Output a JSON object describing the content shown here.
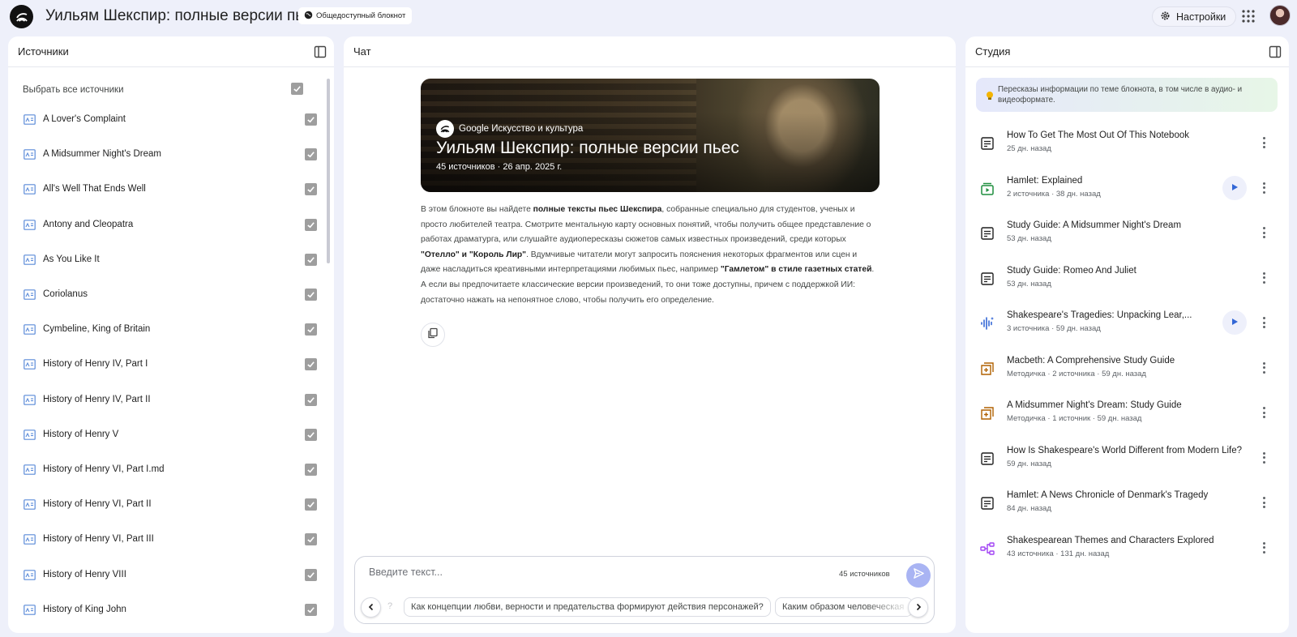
{
  "header": {
    "notebook_title": "Уильям Шекспир: полные версии пьес",
    "public_badge": "Общедоступный блокнот",
    "settings_label": "Настройки"
  },
  "sources": {
    "panel_title": "Источники",
    "select_all": "Выбрать все источники",
    "items": [
      {
        "label": "A Lover's Complaint"
      },
      {
        "label": "A Midsummer Night's Dream"
      },
      {
        "label": "All's Well That Ends Well"
      },
      {
        "label": "Antony and Cleopatra"
      },
      {
        "label": "As You Like It"
      },
      {
        "label": "Coriolanus"
      },
      {
        "label": "Cymbeline, King of Britain"
      },
      {
        "label": "History of Henry IV, Part I"
      },
      {
        "label": "History of Henry IV, Part II"
      },
      {
        "label": "History of Henry V"
      },
      {
        "label": "History of Henry VI, Part I.md"
      },
      {
        "label": "History of Henry VI, Part II"
      },
      {
        "label": "History of Henry VI, Part III"
      },
      {
        "label": "History of Henry VIII"
      },
      {
        "label": "History of King John"
      }
    ]
  },
  "chat": {
    "panel_title": "Чат",
    "hero": {
      "brand": "Google Искусство и культура",
      "title": "Уильям Шекспир: полные версии пьес",
      "meta": "45 источников · 26 апр. 2025 г."
    },
    "description": {
      "p1": "В этом блокноте вы найдете ",
      "b1": "полные тексты пьес Шекспира",
      "p2": ", собранные специально для студентов, ученых и просто любителей театра. Смотрите ментальную карту основных понятий, чтобы получить общее представление о работах драматурга, или слушайте аудиопересказы сюжетов самых известных произведений, среди которых ",
      "b2": "\"Отелло\" и \"Король Лир\"",
      "p3": ". Вдумчивые читатели могут запросить пояснения некоторых фрагментов или сцен и даже насладиться креативными интерпретациями любимых пьес, например ",
      "b3": "\"Гамлетом\" в стиле газетных статей",
      "p4": ". А если вы предпочитаете классические версии произведений, то они тоже доступны, причем с поддержкой ИИ: достаточно нажать на непонятное слово, чтобы получить его определение."
    },
    "composer": {
      "placeholder": "Введите текст...",
      "source_count": "45 источников"
    },
    "suggestions": {
      "ghost": "?",
      "items": [
        "Как концепции любви, верности и предательства формируют действия персонажей?",
        "Каким образом человеческая"
      ]
    }
  },
  "studio": {
    "panel_title": "Студия",
    "banner": "Пересказы информации по теме блокнота, в том числе в аудио- и видеоформате.",
    "notes": [
      {
        "title": "How To Get The Most Out Of This Notebook",
        "meta": "25 дн. назад",
        "icon": "note-icon",
        "playable": false
      },
      {
        "title": "Hamlet: Explained",
        "meta": "2 источника · 38 дн. назад",
        "icon": "video-overview-icon",
        "playable": true
      },
      {
        "title": "Study Guide: A Midsummer Night's Dream",
        "meta": "53 дн. назад",
        "icon": "note-icon",
        "playable": false
      },
      {
        "title": "Study Guide: Romeo And Juliet",
        "meta": "53 дн. назад",
        "icon": "note-icon",
        "playable": false
      },
      {
        "title": "Shakespeare's Tragedies: Unpacking Lear,...",
        "meta": "3 источника · 59 дн. назад",
        "icon": "audio-overview-icon",
        "playable": true
      },
      {
        "title": "Macbeth: A Comprehensive Study Guide",
        "meta": "Методичка · 2 источника · 59 дн. назад",
        "icon": "study-guide-icon",
        "playable": false
      },
      {
        "title": "A Midsummer Night's Dream: Study Guide",
        "meta": "Методичка · 1 источник · 59 дн. назад",
        "icon": "study-guide-icon",
        "playable": false
      },
      {
        "title": "How Is Shakespeare's World Different from Modern Life?",
        "meta": "59 дн. назад",
        "icon": "note-icon",
        "playable": false
      },
      {
        "title": "Hamlet: A News Chronicle of Denmark's Tragedy",
        "meta": "84 дн. назад",
        "icon": "note-icon",
        "playable": false
      },
      {
        "title": "Shakespearean Themes and Characters Explored",
        "meta": "43 источника · 131 дн. назад",
        "icon": "mind-map-icon",
        "playable": false
      }
    ]
  }
}
